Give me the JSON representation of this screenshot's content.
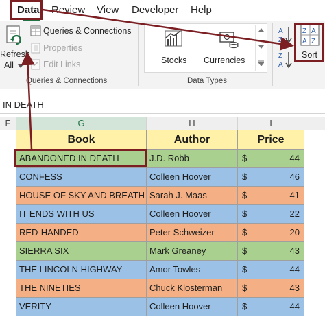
{
  "ribbon_tabs": [
    "Data",
    "Review",
    "View",
    "Developer",
    "Help"
  ],
  "ribbon": {
    "refresh_label": "Refresh",
    "refresh_all_label": "All",
    "queries_connections": "Queries & Connections",
    "properties": "Properties",
    "edit_links": "Edit Links",
    "group_queries": "Queries & Connections",
    "stocks": "Stocks",
    "currencies": "Currencies",
    "group_datatypes": "Data Types",
    "sort": "Sort"
  },
  "formula_bar_text": "IN DEATH",
  "columns": {
    "f": "F",
    "g": "G",
    "h": "H",
    "i": "I"
  },
  "table": {
    "headers": {
      "book": "Book",
      "author": "Author",
      "price": "Price"
    },
    "currency_symbol": "$",
    "rows": [
      {
        "book": "ABANDONED IN DEATH",
        "author": "J.D. Robb",
        "price": "44"
      },
      {
        "book": "CONFESS",
        "author": "Colleen Hoover",
        "price": "46"
      },
      {
        "book": "HOUSE OF SKY AND BREATH",
        "author": "Sarah J. Maas",
        "price": "41"
      },
      {
        "book": "IT ENDS WITH US",
        "author": "Colleen Hoover",
        "price": "22"
      },
      {
        "book": "RED-HANDED",
        "author": "Peter Schweizer",
        "price": "20"
      },
      {
        "book": "SIERRA SIX",
        "author": "Mark Greaney",
        "price": "43"
      },
      {
        "book": "THE LINCOLN HIGHWAY",
        "author": "Amor Towles",
        "price": "44"
      },
      {
        "book": "THE NINETIES",
        "author": "Chuck Klosterman",
        "price": "43"
      },
      {
        "book": "VERITY",
        "author": "Colleen Hoover",
        "price": "44"
      }
    ]
  },
  "colors": {
    "header_fill": "#fff2a8",
    "green_fill": "#a9d08e",
    "blue_fill": "#9bc2e6",
    "orange_fill": "#f4b084",
    "highlight": "#7b1f23",
    "excel_green": "#217346"
  }
}
